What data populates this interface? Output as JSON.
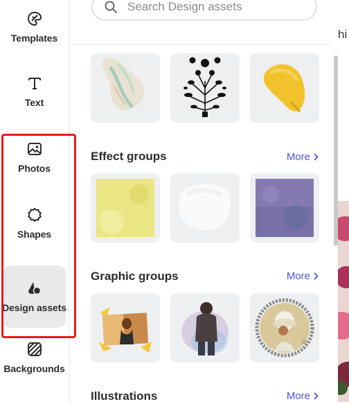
{
  "rail": {
    "items": [
      {
        "label": "Templates",
        "icon": "templates-icon"
      },
      {
        "label": "Text",
        "icon": "text-icon"
      },
      {
        "label": "Photos",
        "icon": "photos-icon"
      },
      {
        "label": "Shapes",
        "icon": "shapes-icon"
      },
      {
        "label": "Design assets",
        "icon": "design-assets-icon",
        "active": true
      },
      {
        "label": "Backgrounds",
        "icon": "backgrounds-icon"
      }
    ]
  },
  "search": {
    "placeholder": "Search Design assets",
    "value": ""
  },
  "sections": {
    "effect_groups": {
      "title": "Effect groups",
      "more": "More"
    },
    "graphic_groups": {
      "title": "Graphic groups",
      "more": "More"
    },
    "illustrations": {
      "title": "Illustrations",
      "more": "More"
    }
  },
  "canvas_peek": {
    "text": "hi"
  },
  "colors": {
    "accent": "#4b55d6",
    "highlight_box": "#e41b1b",
    "active_bg": "#e9e9e9",
    "tile_bg": "#eeeff1"
  }
}
